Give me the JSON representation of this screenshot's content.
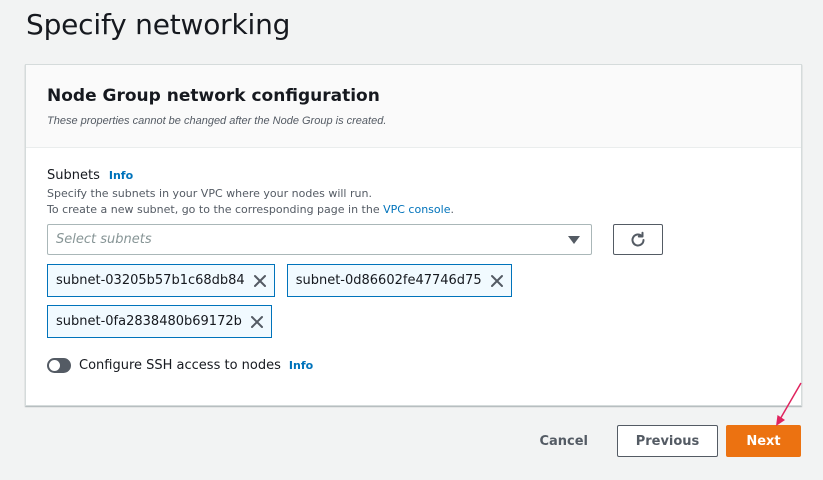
{
  "page": {
    "title": "Specify networking"
  },
  "panel": {
    "title": "Node Group network configuration",
    "description": "These properties cannot be changed after the Node Group is created."
  },
  "subnets": {
    "label": "Subnets",
    "info": "Info",
    "desc_line1": "Specify the subnets in your VPC where your nodes will run.",
    "desc_line2_prefix": "To create a new subnet, go to the corresponding page in the ",
    "desc_line2_link": "VPC console",
    "desc_line2_suffix": ".",
    "placeholder": "Select subnets",
    "selected": [
      "subnet-03205b57b1c68db84",
      "subnet-0d86602fe47746d75",
      "subnet-0fa2838480b69172b"
    ]
  },
  "ssh": {
    "label": "Configure SSH access to nodes",
    "info": "Info",
    "enabled": false
  },
  "footer": {
    "cancel": "Cancel",
    "previous": "Previous",
    "next": "Next"
  },
  "colors": {
    "accent_orange": "#ec7211",
    "link_blue": "#0073bb",
    "token_border": "#0073bb",
    "annotation_arrow": "#e0245e"
  },
  "icons": {
    "select_caret": "caret-down-icon",
    "refresh": "refresh-icon",
    "token_remove": "close-icon",
    "annotation": "arrow-pointer-icon"
  }
}
